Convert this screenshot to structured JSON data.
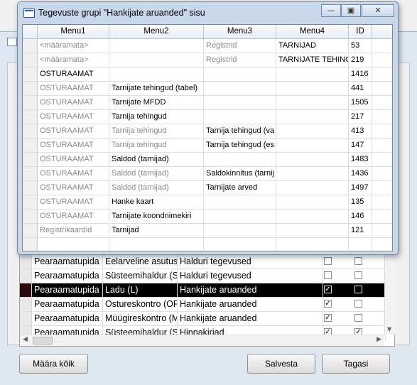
{
  "dialog": {
    "title": "Tegevuste grupi \"Hankijate aruanded\" sisu",
    "minimize_glyph": "—",
    "restore_glyph": "▣",
    "close_glyph": "✕",
    "columns": [
      "Menu1",
      "Menu2",
      "Menu3",
      "Menu4",
      "ID"
    ],
    "rows": [
      {
        "menu1": "<määramata>",
        "menu2": "",
        "menu3": "Registrid",
        "menu4": "TARNIJAD",
        "id": "53",
        "grey": [
          true,
          false,
          true,
          false
        ]
      },
      {
        "menu1": "<määramata>",
        "menu2": "",
        "menu3": "Registrid",
        "menu4": "TARNIJATE TEHING",
        "id": "219",
        "grey": [
          true,
          false,
          true,
          false
        ]
      },
      {
        "menu1": "OSTURAAMAT",
        "menu2": "",
        "menu3": "",
        "menu4": "",
        "id": "1416",
        "grey": [
          false,
          false,
          false,
          false
        ]
      },
      {
        "menu1": "OSTURAAMAT",
        "menu2": "Tarnijate tehingud (tabel)",
        "menu3": "",
        "menu4": "",
        "id": "441",
        "grey": [
          true,
          false,
          false,
          false
        ]
      },
      {
        "menu1": "OSTURAAMAT",
        "menu2": "Tarnijate MFDD",
        "menu3": "",
        "menu4": "",
        "id": "1505",
        "grey": [
          true,
          false,
          false,
          false
        ]
      },
      {
        "menu1": "OSTURAAMAT",
        "menu2": "Tarnija tehingud",
        "menu3": "",
        "menu4": "",
        "id": "217",
        "grey": [
          true,
          false,
          false,
          false
        ]
      },
      {
        "menu1": "OSTURAAMAT",
        "menu2": "Tarnija tehingud",
        "menu3": "Tarnija tehingud (va",
        "menu4": "",
        "id": "413",
        "grey": [
          true,
          true,
          false,
          false
        ]
      },
      {
        "menu1": "OSTURAAMAT",
        "menu2": "Tarnija tehingud",
        "menu3": "Tarnija tehingud (es",
        "menu4": "",
        "id": "147",
        "grey": [
          true,
          true,
          false,
          false
        ]
      },
      {
        "menu1": "OSTURAAMAT",
        "menu2": "Saldod (tarnijad)",
        "menu3": "",
        "menu4": "",
        "id": "1483",
        "grey": [
          true,
          false,
          false,
          false
        ]
      },
      {
        "menu1": "OSTURAAMAT",
        "menu2": "Saldod (tarnijad)",
        "menu3": "Saldokinnitus (tarnij",
        "menu4": "",
        "id": "1436",
        "grey": [
          true,
          true,
          false,
          false
        ]
      },
      {
        "menu1": "OSTURAAMAT",
        "menu2": "Saldod (tarnijad)",
        "menu3": "Tarnijate arved",
        "menu4": "",
        "id": "1497",
        "grey": [
          true,
          true,
          false,
          false
        ]
      },
      {
        "menu1": "OSTURAAMAT",
        "menu2": "Hanke kaart",
        "menu3": "",
        "menu4": "",
        "id": "135",
        "grey": [
          true,
          false,
          false,
          false
        ]
      },
      {
        "menu1": "OSTURAAMAT",
        "menu2": "Tarnijate koondnimekiri",
        "menu3": "",
        "menu4": "",
        "id": "146",
        "grey": [
          true,
          false,
          false,
          false
        ]
      },
      {
        "menu1": "Registrikaardid",
        "menu2": "Tarnijad",
        "menu3": "",
        "menu4": "",
        "id": "121",
        "grey": [
          true,
          false,
          false,
          false
        ]
      },
      {
        "menu1": "",
        "menu2": "",
        "menu3": "",
        "menu4": "",
        "id": "",
        "grey": [
          false,
          false,
          false,
          false
        ]
      }
    ]
  },
  "background_grid": {
    "rows": [
      {
        "c1": "Pearaamatupida",
        "c2": "Eelarveline asutus",
        "c3": "Halduri tegevused",
        "chk1": false,
        "chk2": false,
        "selected": false
      },
      {
        "c1": "Pearaamatupida",
        "c2": "Süsteemihaldur (S",
        "c3": "Halduri tegevused",
        "chk1": false,
        "chk2": false,
        "selected": false
      },
      {
        "c1": "Pearaamatupida",
        "c2": "Ladu (L)",
        "c3": "Hankijate aruanded",
        "chk1": true,
        "chk2": false,
        "selected": true
      },
      {
        "c1": "Pearaamatupida",
        "c2": "Ostureskontro (OR",
        "c3": "Hankijate aruanded",
        "chk1": true,
        "chk2": false,
        "selected": false
      },
      {
        "c1": "Pearaamatupida",
        "c2": "Müügireskontro (M",
        "c3": "Hankijate aruanded",
        "chk1": true,
        "chk2": false,
        "selected": false
      },
      {
        "c1": "Pearaamatupida",
        "c2": "Süsteemihaldur (S",
        "c3": "Hinnakirjad",
        "chk1": true,
        "chk2": true,
        "selected": false
      }
    ]
  },
  "buttons": {
    "select_all": "Määra kõik",
    "save": "Salvesta",
    "back": "Tagasi"
  }
}
